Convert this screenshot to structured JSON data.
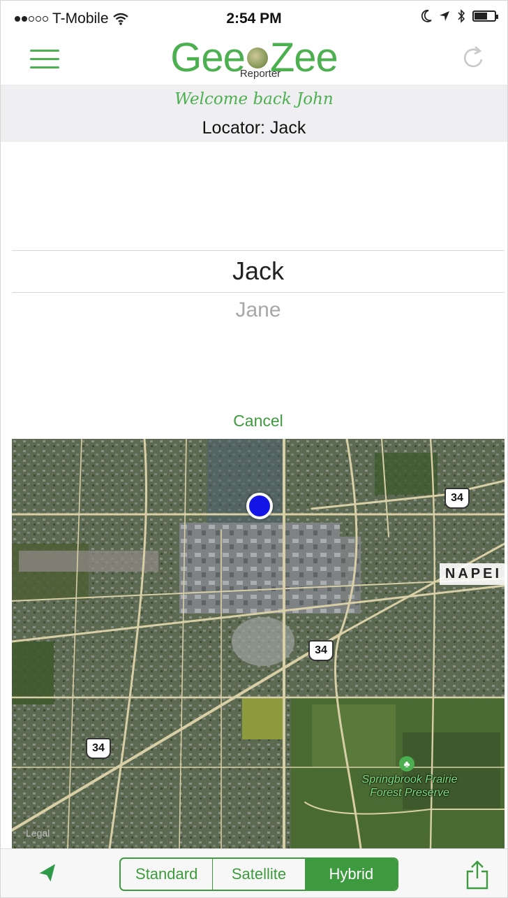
{
  "status_bar": {
    "carrier": "T-Mobile",
    "time": "2:54 PM"
  },
  "header": {
    "logo_left": "Gee",
    "logo_right": "Zee",
    "logo_sub": "Reporter"
  },
  "welcome": {
    "greeting": "Welcome back John",
    "locator": "Locator: Jack"
  },
  "picker": {
    "selected": "Jack",
    "next": "Jane",
    "cancel_label": "Cancel"
  },
  "map": {
    "city_label": "NAPEI",
    "route_shields": [
      "34",
      "34",
      "34"
    ],
    "park_label": "Springbrook Prairie Forest Preserve",
    "legal_label": "Legal"
  },
  "tab_bar": {
    "segments": [
      {
        "label": "Standard",
        "active": false
      },
      {
        "label": "Satellite",
        "active": false
      },
      {
        "label": "Hybrid",
        "active": true
      }
    ]
  },
  "colors": {
    "accent": "#3e9a3e",
    "logo": "#4caf50",
    "location_pin": "#1414e6"
  },
  "icons": [
    "menu-icon",
    "refresh-icon",
    "wifi-icon",
    "moon-icon",
    "location-arrow-icon",
    "bluetooth-icon",
    "battery-icon",
    "locate-arrow-icon",
    "share-icon",
    "park-tree-icon"
  ]
}
